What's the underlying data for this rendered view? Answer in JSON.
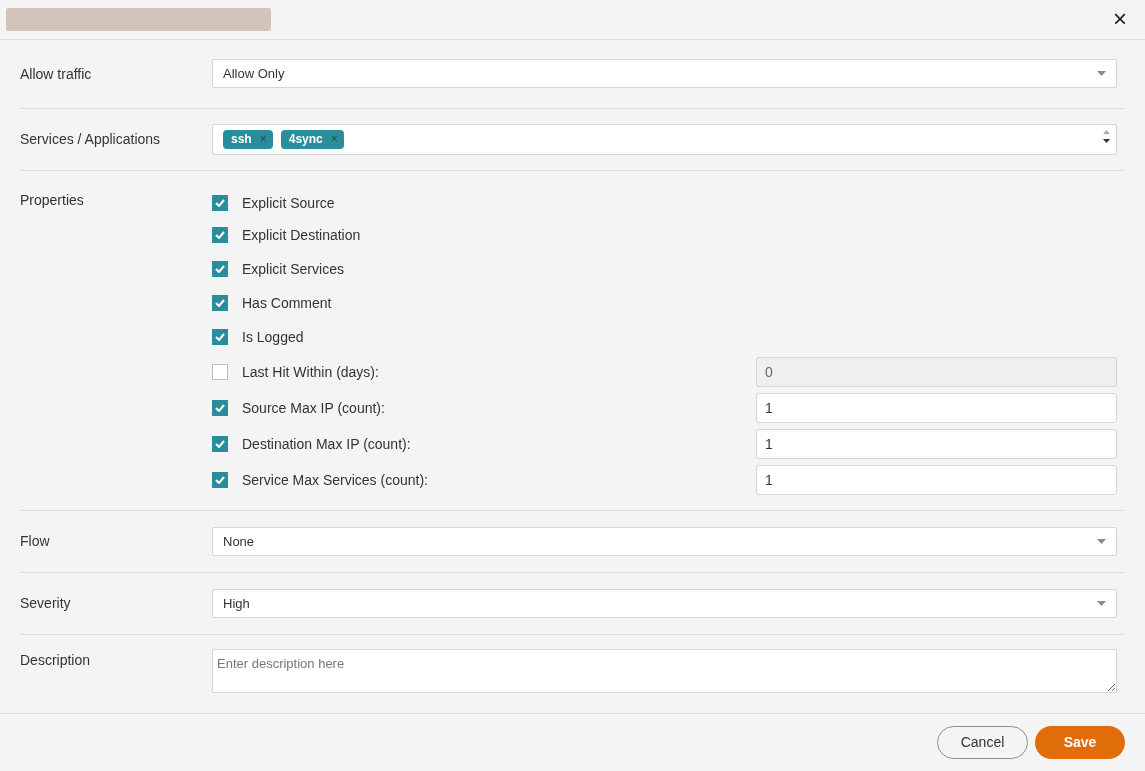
{
  "dialog": {
    "close": "×"
  },
  "fields": [
    {
      "kind": "select",
      "label": "Allow traffic",
      "value": "Allow Only"
    },
    {
      "kind": "tags",
      "label": "Services / Applications",
      "tags": [
        {
          "text": "ssh",
          "remove": "×"
        },
        {
          "text": "4sync",
          "remove": "×"
        }
      ]
    },
    {
      "kind": "properties",
      "label": "Properties",
      "items": [
        {
          "kind": "checkbox",
          "label": "Explicit Source",
          "checked": true
        },
        {
          "kind": "checkbox",
          "label": "Explicit Destination",
          "checked": true
        },
        {
          "kind": "checkbox",
          "label": "Explicit Services",
          "checked": true
        },
        {
          "kind": "checkbox",
          "label": "Has Comment",
          "checked": true
        },
        {
          "kind": "checkbox",
          "label": "Is Logged",
          "checked": true
        },
        {
          "kind": "number",
          "label": "Last Hit Within (days):",
          "checked": false,
          "value": "0",
          "disabled": true
        },
        {
          "kind": "number",
          "label": "Source Max IP (count):",
          "checked": true,
          "value": "1",
          "disabled": false
        },
        {
          "kind": "number",
          "label": "Destination Max IP (count):",
          "checked": true,
          "value": "1",
          "disabled": false
        },
        {
          "kind": "number",
          "label": "Service Max Services (count):",
          "checked": true,
          "value": "1",
          "disabled": false
        }
      ]
    },
    {
      "kind": "select",
      "label": "Flow",
      "value": "None"
    },
    {
      "kind": "select",
      "label": "Severity",
      "value": "High"
    },
    {
      "kind": "textarea",
      "label": "Description",
      "placeholder": "Enter description here"
    }
  ],
  "buttons": [
    {
      "kind": "secondary",
      "label": "Cancel"
    },
    {
      "kind": "primary",
      "label": "Save"
    }
  ]
}
